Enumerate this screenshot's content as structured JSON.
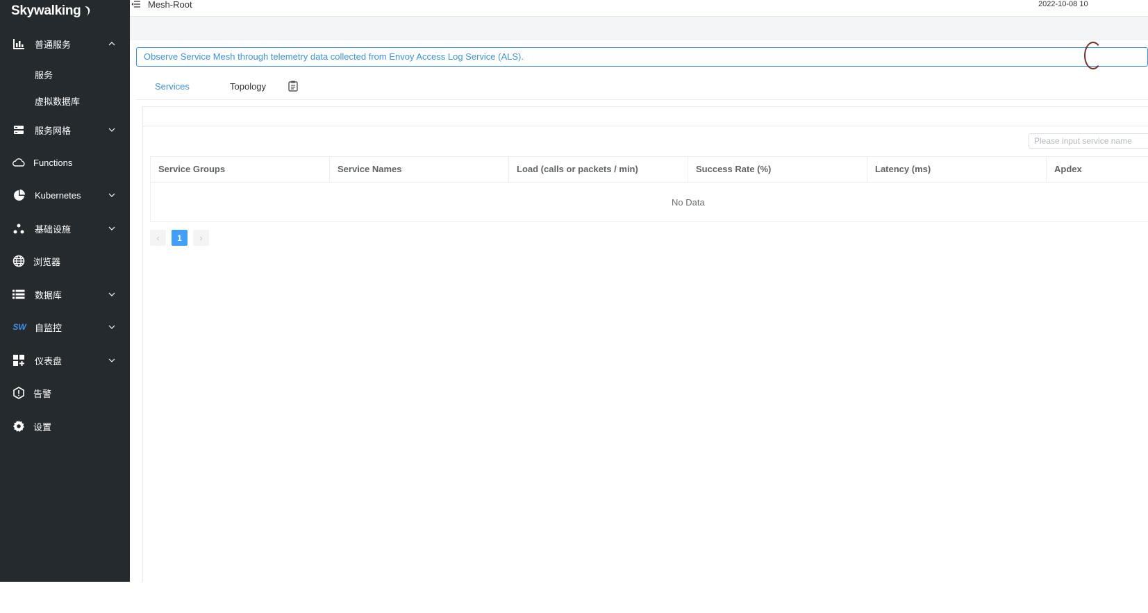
{
  "brand": {
    "name": "Skywalking"
  },
  "sidebar": {
    "items": [
      {
        "label": "普通服务",
        "icon": "chart-icon",
        "chevron": "up"
      },
      {
        "label": "服务网格",
        "icon": "server-icon",
        "chevron": "down"
      },
      {
        "label": "Functions",
        "icon": "cloud-icon",
        "chevron": ""
      },
      {
        "label": "Kubernetes",
        "icon": "pie-icon",
        "chevron": "down"
      },
      {
        "label": "基础设施",
        "icon": "nodes-icon",
        "chevron": "down"
      },
      {
        "label": "浏览器",
        "icon": "globe-icon",
        "chevron": ""
      },
      {
        "label": "数据库",
        "icon": "list-icon",
        "chevron": "down"
      },
      {
        "label": "自监控",
        "icon": "sw-icon",
        "chevron": "down"
      },
      {
        "label": "仪表盘",
        "icon": "dashboard-icon",
        "chevron": "down"
      },
      {
        "label": "告警",
        "icon": "alert-icon",
        "chevron": ""
      },
      {
        "label": "设置",
        "icon": "gear-icon",
        "chevron": ""
      }
    ],
    "sub_items": [
      "服务",
      "虚拟数据库"
    ],
    "sw_icon_text": "SW"
  },
  "header": {
    "title": "Mesh-Root",
    "time": "2022-10-08 10"
  },
  "description": "Observe Service Mesh through telemetry data collected from Envoy Access Log Service (ALS).",
  "tabs": [
    {
      "label": "Services",
      "active": true
    },
    {
      "label": "Topology",
      "active": false
    }
  ],
  "search": {
    "placeholder": "Please input service name"
  },
  "table": {
    "columns": [
      "Service Groups",
      "Service Names",
      "Load (calls or packets / min)",
      "Success Rate (%)",
      "Latency (ms)",
      "Apdex"
    ],
    "empty_text": "No Data"
  },
  "pagination": {
    "current": "1",
    "prev": "‹",
    "next": "›"
  },
  "colors": {
    "sidebar": "#252a2f",
    "accent": "#3d92e7",
    "primary": "#409eff"
  }
}
